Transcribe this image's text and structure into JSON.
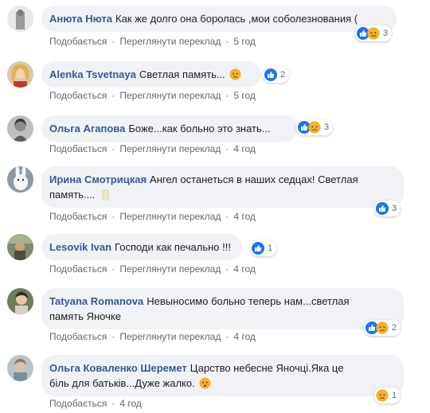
{
  "comments": [
    {
      "author": "Анюта Нюта",
      "text": "Как же долго она боролась ,мои соболезнования (",
      "emoji": "",
      "reactions": [
        "like",
        "sad"
      ],
      "reaction_count": "3",
      "like_label": "Подобається",
      "translate_label": "Переглянути переклад",
      "time": "5 год"
    },
    {
      "author": "Alenka Tsvetnaya",
      "text": "Светлая память...",
      "emoji": "sad-face",
      "reactions": [
        "like"
      ],
      "reaction_count": "2",
      "like_label": "Подобається",
      "translate_label": "Переглянути переклад",
      "time": "5 год"
    },
    {
      "author": "Ольга Агапова",
      "text": "Боже...как больно это знать...",
      "emoji": "",
      "reactions": [
        "like",
        "sad"
      ],
      "reaction_count": "3",
      "like_label": "Подобається",
      "translate_label": "Переглянути переклад",
      "time": "4 год"
    },
    {
      "author": "Ирина Смотрицкая",
      "text_line1": "Ангел останеться в наших седцах! Светлая",
      "text_line2": "память....",
      "emoji": "candle",
      "reactions": [
        "like"
      ],
      "reaction_count": "3",
      "like_label": "Подобається",
      "translate_label": "Переглянути переклад",
      "time": "4 год"
    },
    {
      "author": "Lesovik Ivan",
      "text": "Господи как печально !!!",
      "emoji": "",
      "reactions": [
        "like"
      ],
      "reaction_count": "1",
      "like_label": "Подобається",
      "translate_label": "Переглянути переклад",
      "time": "4 год"
    },
    {
      "author": "Tatyana Romanova",
      "text_line1": "Невыносимо больно теперь нам...светлая",
      "text_line2": "память Яночке",
      "emoji": "",
      "reactions": [
        "like",
        "sad"
      ],
      "reaction_count": "2",
      "like_label": "Подобається",
      "translate_label": "Переглянути переклад",
      "time": "4 год"
    },
    {
      "author": "Ольга Коваленко Шеремет",
      "text_line1": "Царство небесне Яночці.Яка це",
      "text_line2": "біль для батьків...Дуже жалко.",
      "emoji": "crying-face",
      "reactions": [
        "sad"
      ],
      "reaction_count": "1",
      "like_label": "Подобається",
      "time": "4 год"
    }
  ],
  "colors": {
    "author": "#385898",
    "bubble": "#f0f2f5",
    "like_blue": "#1877f2",
    "sad_yellow": "#f7b125",
    "meta": "#65676b"
  }
}
